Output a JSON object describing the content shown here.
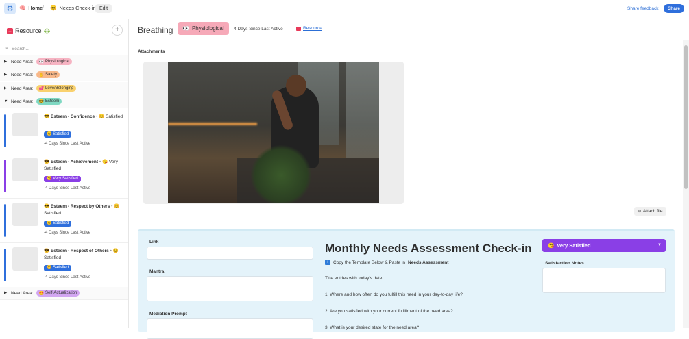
{
  "topbar": {
    "home_label": "Home",
    "home_emoji": "🧠",
    "page_emoji": "😊",
    "page_label": "Needs Check-in",
    "edit_label": "Edit",
    "share_feedback_label": "Share feedback",
    "share_label": "Share",
    "separator": "/"
  },
  "sidebar": {
    "title": "Resource",
    "title_emoji": "❇️",
    "add_label": "+",
    "search_placeholder": "Search...",
    "need_prefix": "Need Area:",
    "groups": [
      {
        "emoji": "👀",
        "label": "Physiological",
        "color": "#f6b3c2"
      },
      {
        "emoji": "✋",
        "label": "Safety",
        "color": "#f8b889"
      },
      {
        "emoji": "💕",
        "label": "Love/Belonging",
        "color": "#f9d16e"
      },
      {
        "emoji": "😎",
        "label": "Esteem",
        "color": "#7fd8c2"
      },
      {
        "emoji": "😍",
        "label": "Self-Actualization",
        "color": "#d2a6f1"
      }
    ],
    "cards": [
      {
        "title_emoji": "😎",
        "title": "Esteem - Confidence",
        "dot": "•",
        "sub_emoji": "😊",
        "sub": "Satisfied",
        "badge_emoji": "😊",
        "badge": "Satisfied",
        "badge_color": "#2f6fdc",
        "bar_color": "#2f6fdc",
        "meta": "-4 Days Since Last Active"
      },
      {
        "title_emoji": "😎",
        "title": "Esteem - Achievement",
        "dot": "•",
        "sub_emoji": "😘",
        "sub": "Very Satisfied",
        "badge_emoji": "😘",
        "badge": "Very Satisfied",
        "badge_color": "#8a3fe6",
        "bar_color": "#8a3fe6",
        "meta": "-4 Days Since Last Active"
      },
      {
        "title_emoji": "😎",
        "title": "Esteem - Respect by Others",
        "dot": "•",
        "sub_emoji": "😊",
        "sub": "Satisfied",
        "badge_emoji": "😊",
        "badge": "Satisfied",
        "badge_color": "#2f6fdc",
        "bar_color": "#2f6fdc",
        "meta": "-4 Days Since Last Active"
      },
      {
        "title_emoji": "😎",
        "title": "Esteem - Respect of Others",
        "dot": "•",
        "sub_emoji": "😊",
        "sub": "Satisfied",
        "badge_emoji": "😊",
        "badge": "Satisfied",
        "badge_color": "#2f6fdc",
        "bar_color": "#2f6fdc",
        "meta": "-4 Days Since Last Active"
      }
    ]
  },
  "main": {
    "title": "Breathing",
    "pill_emoji": "👀",
    "pill_label": "Physiological",
    "days_label": "-4 Days Since Last Active",
    "resource_link": "Resource",
    "attachments_label": "Attachments",
    "attach_file_label": "Attach file",
    "form": {
      "link_label": "Link",
      "mantra_label": "Mantra",
      "mediation_label": "Mediation Prompt",
      "title": "Monthly Needs Assessment Check-in",
      "copy_text": "Copy the Template Below & Paste in",
      "copy_bold": "Needs Assessment",
      "line1": "Title entries with today's date",
      "line2": "1. Where and how often do you fulfill this need in your day-to-day life?",
      "line3": "2. Are you satisfied with your current fulfillment of the need area?",
      "line4": "3. What is your desired state for the need area?",
      "satisfaction_emoji": "😘",
      "satisfaction_value": "Very Satisfied",
      "satisfaction_notes_label": "Satisfaction Notes"
    }
  },
  "icons": {
    "app": "gear-icon",
    "search": "search-icon",
    "attach": "paperclip-icon",
    "caret": "caret-down-icon",
    "info": "info-icon"
  }
}
